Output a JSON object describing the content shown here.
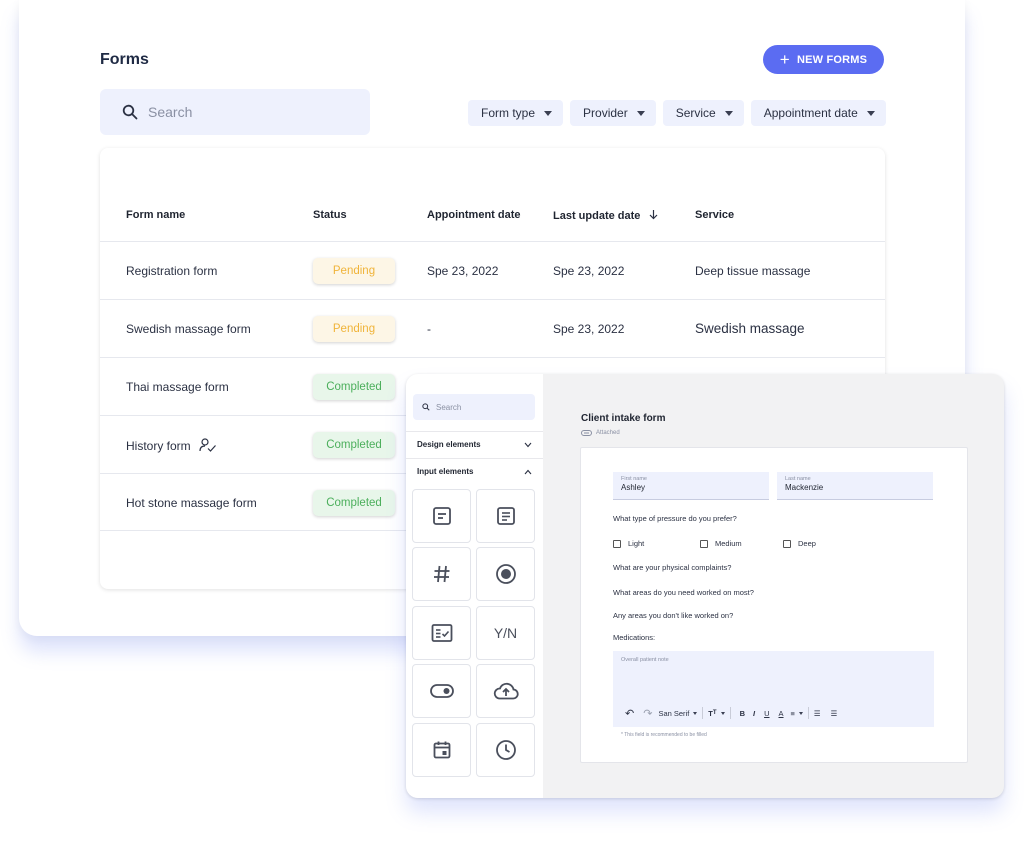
{
  "header": {
    "title": "Forms",
    "new_button": "NEW FORMS"
  },
  "search": {
    "placeholder": "Search"
  },
  "filters": [
    "Form type",
    "Provider",
    "Service",
    "Appointment date"
  ],
  "table": {
    "columns": [
      "Form name",
      "Status",
      "Appointment date",
      "Last update date",
      "Service"
    ],
    "rows": [
      {
        "name": "Registration form",
        "status": "Pending",
        "appointment": "Spe 23, 2022",
        "updated": "Spe 23, 2022",
        "service": "Deep tissue massage"
      },
      {
        "name": "Swedish massage form",
        "status": "Pending",
        "appointment": "-",
        "updated": "Spe 23, 2022",
        "service": "Swedish massage"
      },
      {
        "name": "Thai massage form",
        "status": "Completed"
      },
      {
        "name": "History form",
        "status": "Completed"
      },
      {
        "name": "Hot stone massage form",
        "status": "Completed"
      }
    ]
  },
  "builder": {
    "search_placeholder": "Search",
    "design_section": "Design elements",
    "input_section": "Input elements",
    "yn_label": "Y/N",
    "form_title": "Client intake form",
    "attached": "Attached",
    "first_name_label": "First name",
    "first_name_value": "Ashley",
    "last_name_label": "Last name",
    "last_name_value": "Mackenzie",
    "q_pressure": "What type of pressure do you prefer?",
    "options": [
      "Light",
      "Medium",
      "Deep"
    ],
    "q_complaints": "What are your physical complaints?",
    "q_areas": "What areas do you need worked on most?",
    "q_avoid": "Any areas you don't like worked on?",
    "q_meds": "Medications:",
    "note_placeholder": "Overall patient note",
    "font_select": "San Serif",
    "hint": "* This field is recommended to be filled"
  },
  "colors": {
    "accent": "#5b6cf2",
    "pending": "#f0b43a",
    "completed": "#4caf5c"
  }
}
